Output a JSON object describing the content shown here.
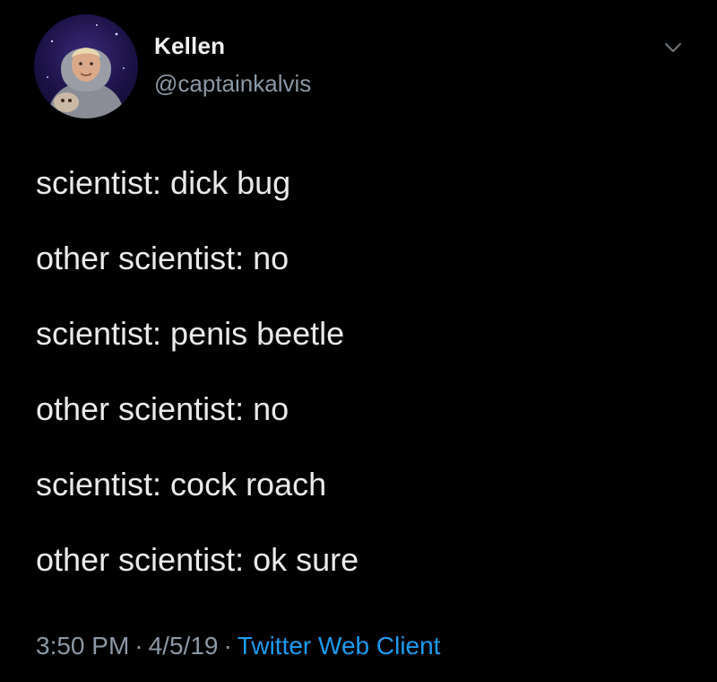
{
  "author": {
    "name": "Kellen",
    "handle": "@captainkalvis"
  },
  "lines": [
    "scientist: dick bug",
    "other scientist: no",
    "scientist: penis beetle",
    "other scientist: no",
    "scientist: cock roach",
    "other scientist: ok sure"
  ],
  "meta": {
    "time": "3:50 PM",
    "date": "4/5/19",
    "separator": "·",
    "client": "Twitter Web Client"
  },
  "icons": {
    "menu": "chevron-down-icon"
  },
  "colors": {
    "background": "#000000",
    "text": "#e9eaeb",
    "secondary": "#8b98a5",
    "link": "#1d9bf0"
  }
}
